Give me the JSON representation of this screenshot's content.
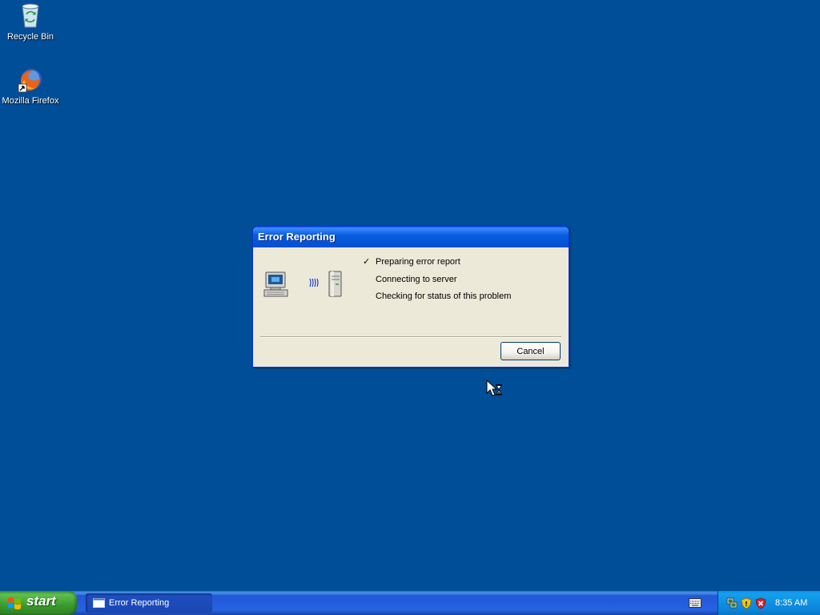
{
  "desktop": {
    "background": "#004e98",
    "icons": [
      {
        "label": "Recycle Bin",
        "icon": "recycle-bin-icon"
      },
      {
        "label": "Mozilla Firefox",
        "icon": "firefox-icon"
      }
    ]
  },
  "dialog": {
    "title": "Error Reporting",
    "steps": [
      {
        "label": "Preparing error report",
        "done": true
      },
      {
        "label": "Connecting to server",
        "done": false
      },
      {
        "label": "Checking for status of this problem",
        "done": false
      }
    ],
    "check_glyph": "✓",
    "cancel_label": "Cancel",
    "illustration": [
      "computer-icon",
      "transmission-waves-icon",
      "server-icon"
    ]
  },
  "cursor": "busy-arrow-cursor",
  "taskbar": {
    "start_label": "start",
    "tasks": [
      {
        "label": "Error Reporting",
        "active": true
      }
    ],
    "tray": {
      "icons": [
        "network-icon",
        "security-shield-icon",
        "security-alert-icon"
      ],
      "clock": "8:35 AM"
    },
    "language_bar_icon": "keyboard-icon"
  }
}
